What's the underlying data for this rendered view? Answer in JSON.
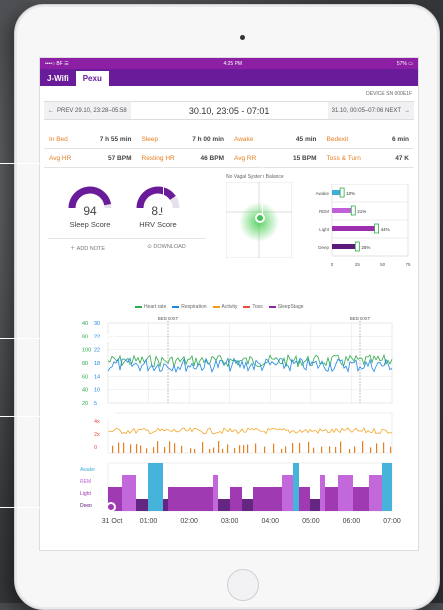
{
  "status": {
    "left": "••••○ BF ☰",
    "time": "4:25 PM",
    "battery": "57%"
  },
  "tabs": [
    {
      "label": "J-Wifi"
    },
    {
      "label": "Pexu"
    }
  ],
  "device_id": "DEVICE SN 000E1F",
  "nav": {
    "prev": "PREV 29.10, 23:28–05:58",
    "title": "30.10, 23:05 - 07:01",
    "next": "31.10, 00:05–07:06 NEXT"
  },
  "stats": [
    [
      {
        "label": "In Bed",
        "value": "7 h 55 min"
      },
      {
        "label": "Sleep",
        "value": "7 h 00 min"
      },
      {
        "label": "Awake",
        "value": "45 min"
      },
      {
        "label": "Bedexit",
        "value": "6 min"
      }
    ],
    [
      {
        "label": "Avg HR",
        "value": "57 BPM"
      },
      {
        "label": "Resting HR",
        "value": "46 BPM"
      },
      {
        "label": "Avg RR",
        "value": "15 BPM"
      },
      {
        "label": "Toss & Turn",
        "value": "47 K"
      }
    ]
  ],
  "gauges": [
    {
      "value": "94",
      "label": "Sleep Score",
      "fraction": 0.94
    },
    {
      "value": "81",
      "label": "HRV Score",
      "fraction": 0.81
    }
  ],
  "actions": {
    "add_note": "ADD NOTE",
    "download": "DOWNLOAD"
  },
  "balance_title": "No Vagal System Balance",
  "stages_bar": {
    "categories": [
      "Awake",
      "REM",
      "Light",
      "Deep"
    ],
    "values": [
      10,
      21,
      44,
      25
    ],
    "labels": [
      "10%",
      "21%",
      "44%",
      "25%"
    ],
    "colors": [
      "#3cb0d8",
      "#c060d8",
      "#9b2fae",
      "#5c1a7a"
    ],
    "ticks": [
      "0",
      "25",
      "50",
      "75"
    ]
  },
  "legend": [
    {
      "label": "Heart rate",
      "color": "#2eaa4a"
    },
    {
      "label": "Respiration",
      "color": "#1e88e5"
    },
    {
      "label": "Activity",
      "color": "#f39c12"
    },
    {
      "label": "Toss",
      "color": "#e74c3c"
    },
    {
      "label": "SleepStage",
      "color": "#8e24aa"
    }
  ],
  "markers": [
    "BED EXIT",
    "BED EXIT"
  ],
  "y_left": [
    "40",
    "80",
    "100",
    "80",
    "60",
    "40",
    "20"
  ],
  "y_right": [
    "30",
    "22",
    "22",
    "18",
    "14",
    "10",
    "5"
  ],
  "stage_y": [
    "Awake",
    "REM",
    "Light",
    "Deep"
  ],
  "x_times": [
    "31 Oct",
    "01:00",
    "02:00",
    "03:00",
    "04:00",
    "05:00",
    "06:00",
    "07:00"
  ],
  "activity_y": [
    "4x",
    "2x",
    "0"
  ]
}
